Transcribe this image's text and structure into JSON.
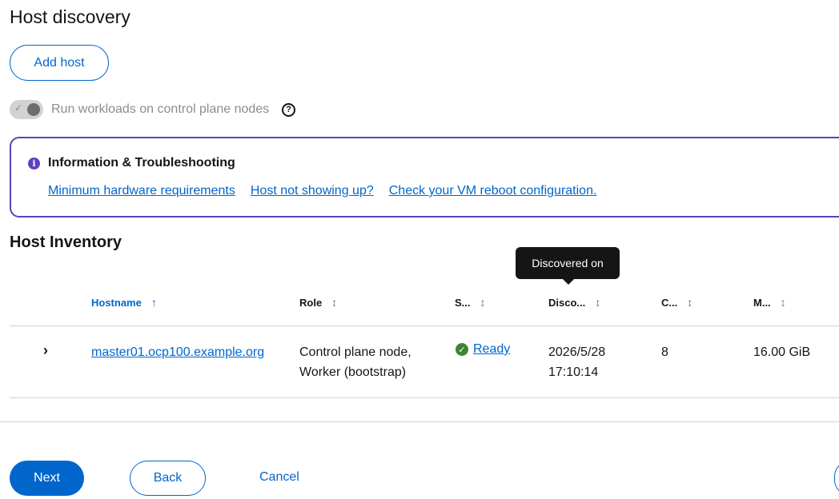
{
  "page": {
    "title": "Host discovery"
  },
  "actions": {
    "add_host": "Add host"
  },
  "switch": {
    "label": "Run workloads on control plane nodes",
    "checked": false,
    "disabled": true
  },
  "alert": {
    "title": "Information & Troubleshooting",
    "links": [
      "Minimum hardware requirements",
      "Host not showing up?",
      "Check your VM reboot configuration."
    ]
  },
  "inventory": {
    "title": "Host Inventory",
    "tooltip": "Discovered on",
    "columns": [
      "Hostname",
      "Role",
      "S...",
      "Disco...",
      "C...",
      "M..."
    ],
    "rows": [
      {
        "hostname": "master01.ocp100.example.org",
        "role_line1": "Control plane node,",
        "role_line2": "Worker (bootstrap)",
        "status": "Ready",
        "discovered_date": "2026/5/28",
        "discovered_time": "17:10:14",
        "cpu": "8",
        "memory": "16.00 GiB"
      }
    ]
  },
  "footer": {
    "next": "Next",
    "back": "Back",
    "cancel": "Cancel"
  },
  "colors": {
    "primary": "#0066cc",
    "alert_border": "#5e40be",
    "success": "#3e8635"
  }
}
